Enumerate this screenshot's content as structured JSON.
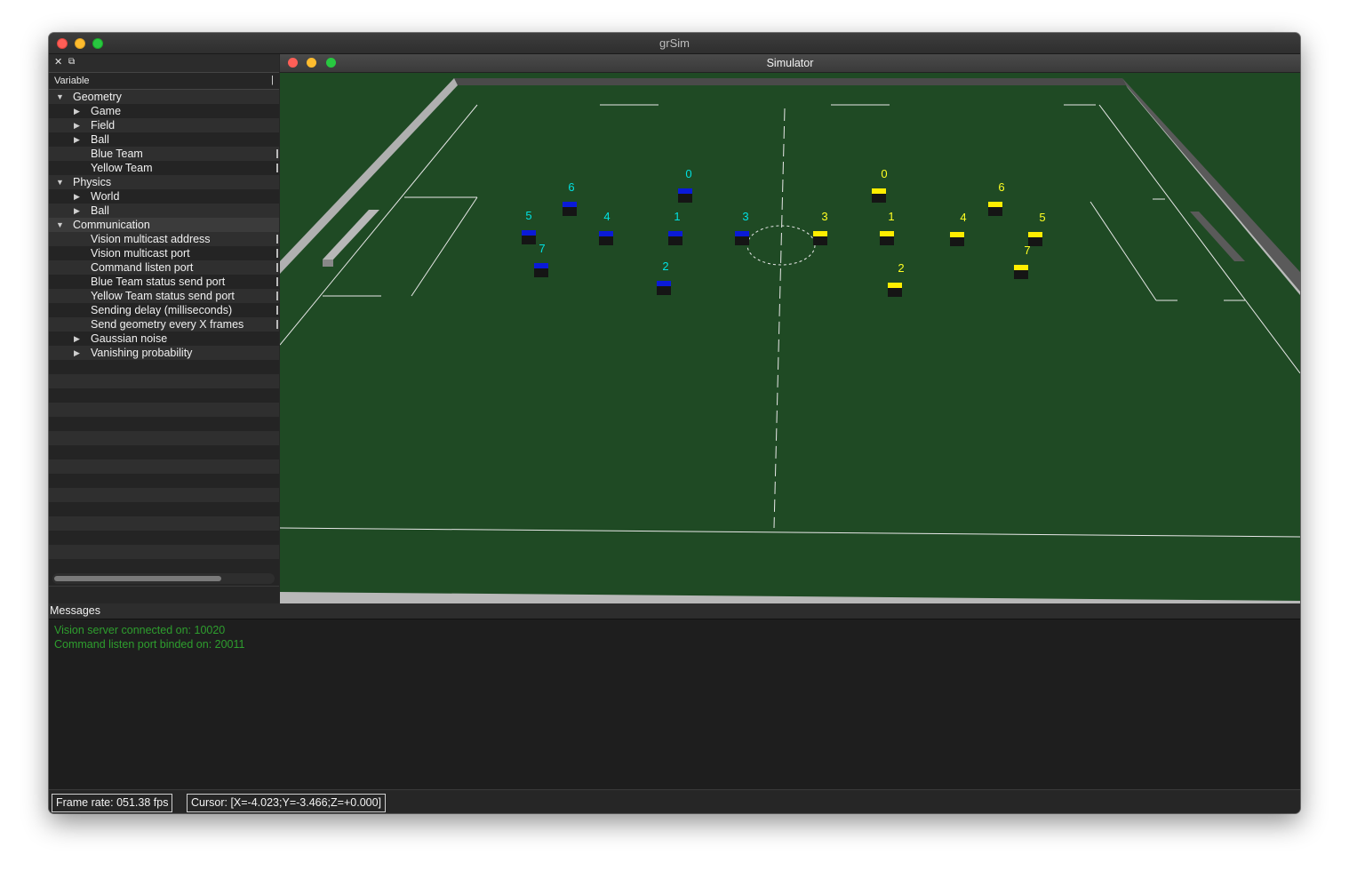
{
  "window": {
    "title": "grSim"
  },
  "dock": {
    "close_glyph": "✕",
    "float_glyph": "⧉",
    "column_header": "Variable",
    "tree": [
      {
        "label": "Geometry",
        "level": 0,
        "arrow": "down"
      },
      {
        "label": "Game",
        "level": 1,
        "arrow": "right"
      },
      {
        "label": "Field",
        "level": 1,
        "arrow": "right"
      },
      {
        "label": "Ball",
        "level": 1,
        "arrow": "right"
      },
      {
        "label": "Blue Team",
        "level": 1,
        "arrow": "none"
      },
      {
        "label": "Yellow Team",
        "level": 1,
        "arrow": "none"
      },
      {
        "label": "Physics",
        "level": 0,
        "arrow": "down"
      },
      {
        "label": "World",
        "level": 1,
        "arrow": "right"
      },
      {
        "label": "Ball",
        "level": 1,
        "arrow": "right"
      },
      {
        "label": "Communication",
        "level": 0,
        "arrow": "down",
        "selected": true
      },
      {
        "label": "Vision multicast address",
        "level": 1,
        "arrow": "none"
      },
      {
        "label": "Vision multicast port",
        "level": 1,
        "arrow": "none"
      },
      {
        "label": "Command listen port",
        "level": 1,
        "arrow": "none"
      },
      {
        "label": "Blue Team status send port",
        "level": 1,
        "arrow": "none"
      },
      {
        "label": "Yellow Team status send port",
        "level": 1,
        "arrow": "none"
      },
      {
        "label": "Sending delay (milliseconds)",
        "level": 1,
        "arrow": "none"
      },
      {
        "label": "Send geometry every X frames",
        "level": 1,
        "arrow": "none"
      },
      {
        "label": "Gaussian noise",
        "level": 1,
        "arrow": "right"
      },
      {
        "label": "Vanishing probability",
        "level": 1,
        "arrow": "right"
      }
    ]
  },
  "simulator": {
    "title": "Simulator",
    "colors": {
      "field": "#1f4a24",
      "blue_team": "#0a1ad8",
      "yellow_team": "#ffee00",
      "blue_label": "#00e0e0",
      "yellow_label": "#ffff22"
    },
    "blue_robots": [
      "0",
      "6",
      "5",
      "4",
      "1",
      "3",
      "7",
      "2"
    ],
    "yellow_robots": [
      "0",
      "6",
      "3",
      "1",
      "4",
      "5",
      "7",
      "2"
    ]
  },
  "messages": {
    "title": "Messages",
    "lines": [
      "Vision server connected on: 10020",
      "Command listen port binded on: 20011"
    ]
  },
  "status": {
    "frame_rate": "Frame rate: 051.38 fps",
    "cursor": "Cursor: [X=-4.023;Y=-3.466;Z=+0.000]"
  }
}
